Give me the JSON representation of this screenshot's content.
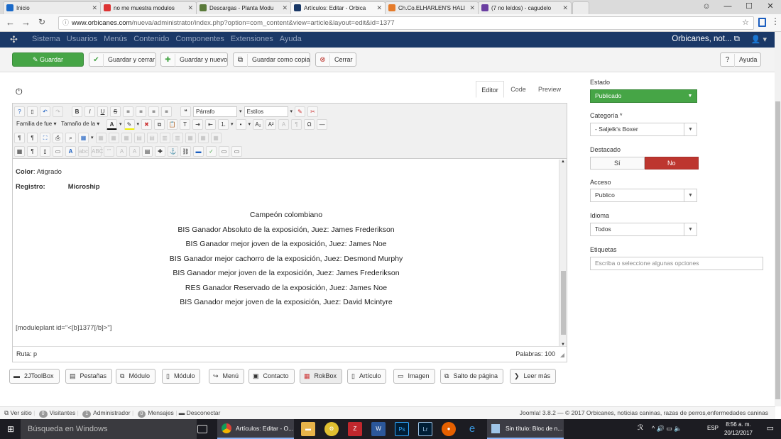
{
  "browser": {
    "tabs": [
      {
        "title": "Inicio",
        "color": "#1b6ac9"
      },
      {
        "title": "no me muestra modulos",
        "color": "#d33"
      },
      {
        "title": "Descargas - Planta Modu",
        "color": "#5a7a3a"
      },
      {
        "title": "Artículos: Editar - Orbica",
        "color": "#1a3867"
      },
      {
        "title": "Ch.Co.ELHARLEN'S HALI",
        "color": "#e57b2a"
      },
      {
        "title": "(7 no leídos) - cagudelo",
        "color": "#6a3ea1"
      }
    ],
    "url_host": "www.orbicanes.com",
    "url_path": "/nueva/administrator/index.php?option=com_content&view=article&layout=edit&id=1377"
  },
  "jnav": {
    "menu": [
      "Sistema",
      "Usuarios",
      "Menús",
      "Contenido",
      "Componentes",
      "Extensiones",
      "Ayuda"
    ],
    "site": "Orbicanes, not..."
  },
  "toolbar": {
    "save": "Guardar",
    "save_close": "Guardar y cerrar",
    "save_new": "Guardar y nuevo",
    "save_copy": "Guardar como copia",
    "close": "Cerrar",
    "help": "Ayuda"
  },
  "editor": {
    "tabs": [
      "Editor",
      "Code",
      "Preview"
    ],
    "toolbar": {
      "paragraph": "Párrafo",
      "styles": "Estilos",
      "font_family": "Familia de fue",
      "font_size": "Tamaño de la"
    },
    "content": {
      "color_label": "Color",
      "color_value": ": Atigrado",
      "registro_label": "Registro:",
      "registro_value": "Microship",
      "lines": [
        "Campeón colombiano",
        "BIS Ganador Absoluto de la exposición, Juez: James Frederikson",
        "BIS Ganador mejor joven de la exposición, Juez: James Noe",
        "BIS Ganador mejor cachorro de la exposición, Juez: Desmond Murphy",
        "BIS Ganador mejor joven de la exposición, Juez: James Frederikson",
        "RES Ganador Reservado de la exposición, Juez: James Noe",
        "BIS Ganador mejor joven de la exposición, Juez: David Mcintyre"
      ],
      "module_tag": "[moduleplant id=\"<[b]1377[/b]>\"]"
    },
    "path_label": "Ruta:",
    "path_value": "p",
    "words_label": "Palabras:",
    "words_value": "100"
  },
  "plugin_buttons": [
    "2JToolBox",
    "Pestañas",
    "Módulo",
    "Módulo",
    "Menú",
    "Contacto",
    "RokBox",
    "Artículo",
    "Imagen",
    "Salto de página",
    "Leer más"
  ],
  "sidebar": {
    "estado_label": "Estado",
    "estado_value": "Publicado",
    "categoria_label": "Categoría *",
    "categoria_value": "- Saljelk's Boxer",
    "destacado_label": "Destacado",
    "destacado_yes": "Sí",
    "destacado_no": "No",
    "acceso_label": "Acceso",
    "acceso_value": "Publico",
    "idioma_label": "Idioma",
    "idioma_value": "Todos",
    "etiquetas_label": "Etiquetas",
    "etiquetas_placeholder": "Escriba o seleccione algunas opciones"
  },
  "footer": {
    "ver_sitio": "Ver sitio",
    "visitantes_count": "0",
    "visitantes": "Visitantes",
    "admin_count": "1",
    "admin": "Administrador",
    "mensajes_count": "0",
    "mensajes": "Mensajes",
    "desconectar": "Desconectar",
    "copyright": "Joomla! 3.8.2 — © 2017 Orbicanes, noticias caninas, razas de perros,enfermedades caninas"
  },
  "taskbar": {
    "search": "Búsqueda en Windows",
    "chrome_window": "Artículos: Editar - O...",
    "notepad_window": "Sin título: Bloc de n...",
    "lang": "ESP",
    "time": "8:56 a. m.",
    "date": "20/12/2017"
  },
  "colors": {
    "nav": "#1a3867",
    "success": "#46a546",
    "danger": "#bd362f"
  }
}
